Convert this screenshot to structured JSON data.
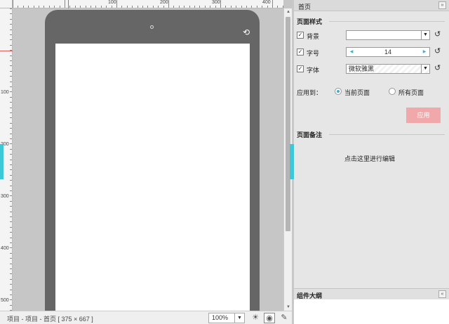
{
  "ruler": {
    "top_labels": [
      "100",
      "200",
      "300",
      "400"
    ],
    "left_labels": [
      "100",
      "200",
      "300",
      "400",
      "500"
    ]
  },
  "device": {
    "rotate_icon": "rotate-icon",
    "camera_icon": "camera-icon"
  },
  "status": {
    "breadcrumb": "项目 - 项目 - 首页 [ 375 × 667 ]",
    "zoom": "100%",
    "icons": [
      "sun-icon",
      "eye-icon",
      "wrench-icon"
    ]
  },
  "panel": {
    "title": "首页",
    "page_style": {
      "title": "页面样式",
      "background_label": "背景",
      "font_size_label": "字号",
      "font_size_value": "14",
      "font_label": "字体",
      "font_value": "微软雅黑"
    },
    "apply_to": {
      "label": "应用到：",
      "option_current": "当前页面",
      "option_all": "所有页面",
      "selected": "当前页面"
    },
    "apply_button": "应用",
    "notes": {
      "title": "页面备注",
      "edit_hint": "点击这里进行编辑"
    },
    "outline": {
      "title": "组件大纲"
    }
  }
}
